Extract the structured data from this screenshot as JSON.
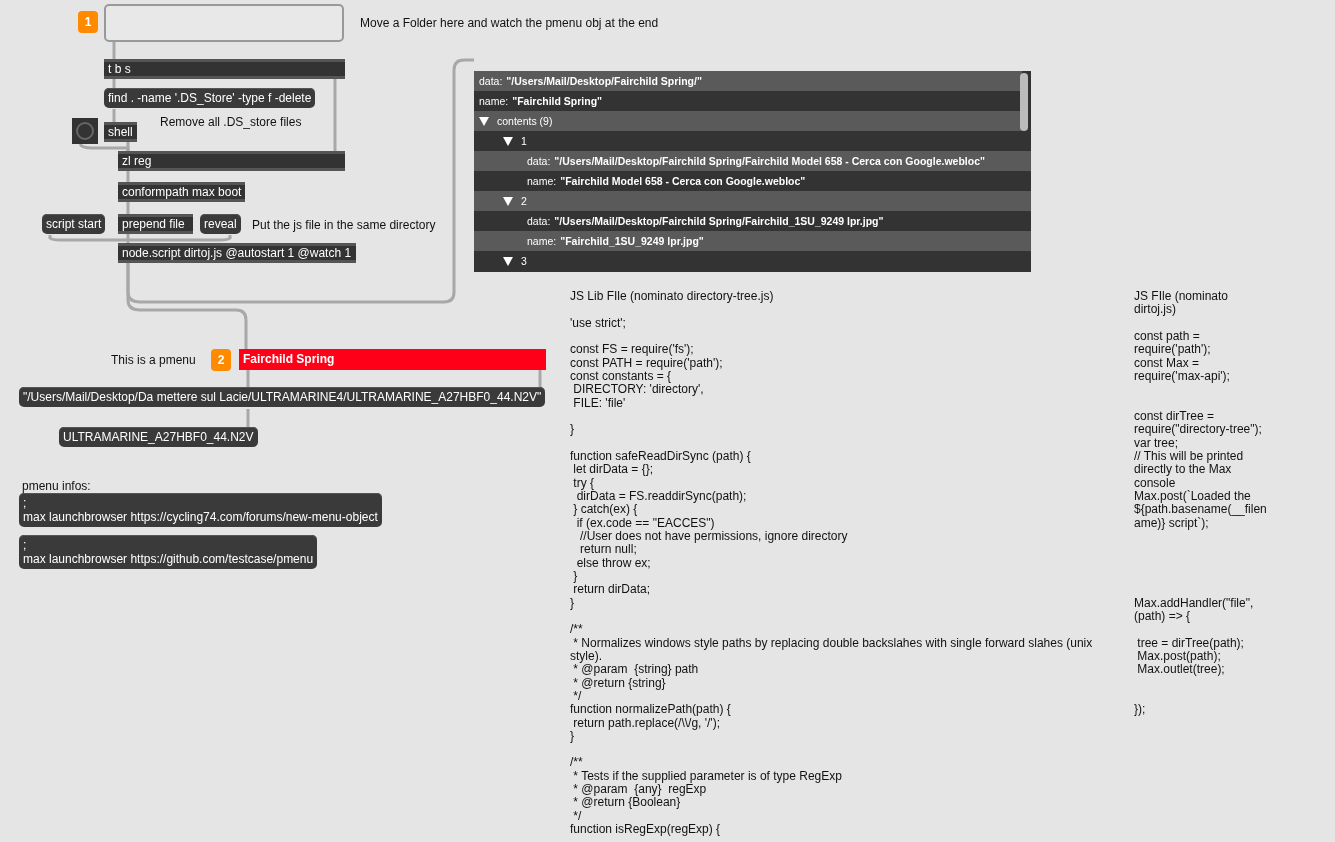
{
  "objects": [
    {
      "kind": "badge",
      "text": "1"
    },
    {
      "kind": "dropzone"
    },
    {
      "kind": "comment",
      "text": "Move a Folder here and watch the pmenu obj at the end"
    },
    {
      "kind": "object",
      "text": "t b s"
    },
    {
      "kind": "message",
      "text": "find . -name '.DS_Store' -type f -delete"
    },
    {
      "kind": "comment",
      "text": "Remove all .DS_store files"
    },
    {
      "kind": "bang"
    },
    {
      "kind": "object",
      "text": "shell"
    },
    {
      "kind": "object",
      "text": "zl reg"
    },
    {
      "kind": "object",
      "text": "conformpath max boot"
    },
    {
      "kind": "message",
      "text": "script start"
    },
    {
      "kind": "object",
      "text": "prepend file"
    },
    {
      "kind": "message",
      "text": "reveal"
    },
    {
      "kind": "comment",
      "text": "Put the js file in the same directory"
    },
    {
      "kind": "object",
      "text": "node.script dirtoj.js @autostart 1 @watch 1"
    },
    {
      "kind": "comment",
      "text": "This is a pmenu"
    },
    {
      "kind": "badge",
      "text": "2"
    },
    {
      "kind": "pmenu",
      "text": "Fairchild Spring"
    },
    {
      "kind": "message",
      "text": "\"/Users/Mail/Desktop/Da mettere sul Lacie/ULTRAMARINE4/ULTRAMARINE_A27HBF0_44.N2V\""
    },
    {
      "kind": "message",
      "text": "ULTRAMARINE_A27HBF0_44.N2V"
    },
    {
      "kind": "comment",
      "text": "pmenu infos:"
    },
    {
      "kind": "message",
      "text": ";\nmax launchbrowser https://cycling74.com/forums/new-menu-object"
    },
    {
      "kind": "message",
      "text": ";\nmax launchbrowser https://github.com/testcase/pmenu"
    }
  ],
  "dict_view": {
    "rows": [
      {
        "kind": "entry",
        "key": "data:",
        "value": "\"/Users/Mail/Desktop/Fairchild Spring/\""
      },
      {
        "kind": "entry",
        "key": "name:",
        "value": "\"Fairchild Spring\""
      },
      {
        "kind": "group",
        "label": "contents (9)",
        "expanded": true,
        "children": [
          {
            "kind": "group",
            "label": "1",
            "expanded": true,
            "children": [
              {
                "kind": "entry",
                "key": "data:",
                "value": "\"/Users/Mail/Desktop/Fairchild Spring/Fairchild Model 658 - Cerca con Google.webloc\""
              },
              {
                "kind": "entry",
                "key": "name:",
                "value": "\"Fairchild Model 658 - Cerca con Google.webloc\""
              }
            ]
          },
          {
            "kind": "group",
            "label": "2",
            "expanded": true,
            "children": [
              {
                "kind": "entry",
                "key": "data:",
                "value": "\"/Users/Mail/Desktop/Fairchild Spring/Fairchild_1SU_9249 lpr.jpg\""
              },
              {
                "kind": "entry",
                "key": "name:",
                "value": "\"Fairchild_1SU_9249 lpr.jpg\""
              }
            ]
          },
          {
            "kind": "group",
            "label": "3",
            "expanded": true
          }
        ]
      }
    ]
  },
  "code_comments": [
    {
      "text": "JS Lib FIle (nominato directory-tree.js)\n\n'use strict';\n\nconst FS = require('fs');\nconst PATH = require('path');\nconst constants = {\n DIRECTORY: 'directory',\n FILE: 'file'\n\n}\n\nfunction safeReadDirSync (path) {\n let dirData = {};\n try {\n  dirData = FS.readdirSync(path);\n } catch(ex) {\n  if (ex.code == \"EACCES\")\n   //User does not have permissions, ignore directory\n   return null;\n  else throw ex;\n }\n return dirData;\n}\n\n/**\n * Normalizes windows style paths by replacing double backslahes with single forward slahes (unix style).\n * @param  {string} path\n * @return {string}\n */\nfunction normalizePath(path) {\n return path.replace(/\\\\/g, '/');\n}\n\n/**\n * Tests if the supplied parameter is of type RegExp\n * @param  {any}  regExp\n * @return {Boolean}\n */\nfunction isRegExp(regExp) {"
    },
    {
      "text": "JS FIle (nominato dirtoj.js)\n\nconst path = require('path');\nconst Max = require('max-api');\n\n\nconst dirTree = require(\"directory-tree\");\nvar tree;\n// This will be printed directly to the Max console\nMax.post(`Loaded the ${path.basename(__filename)} script`);\n\n\n\n\n\nMax.addHandler(\"file\", (path) => {\n\n tree = dirTree(path);\n Max.post(path);\n Max.outlet(tree);\n\n\n});"
    }
  ]
}
